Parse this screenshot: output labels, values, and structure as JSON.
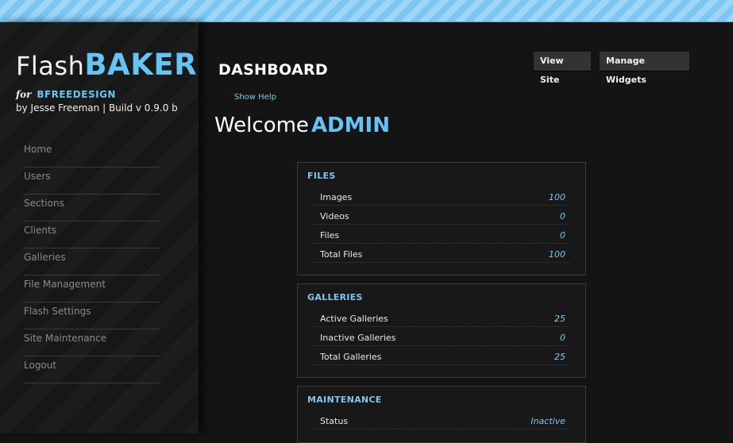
{
  "brand": {
    "name_part1": "Flash",
    "name_part2": "BAKER",
    "for_word": "for",
    "client": "BFREEDESIGN",
    "byline": "by Jesse Freeman | Build v 0.9.0 b"
  },
  "sidebar": {
    "items": [
      {
        "label": "Home"
      },
      {
        "label": "Users"
      },
      {
        "label": "Sections"
      },
      {
        "label": "Clients"
      },
      {
        "label": "Galleries"
      },
      {
        "label": "File Management"
      },
      {
        "label": "Flash Settings"
      },
      {
        "label": "Site Maintenance"
      },
      {
        "label": "Logout"
      }
    ]
  },
  "header": {
    "title": "DASHBOARD",
    "show_help": "Show Help",
    "view_site": "View Site",
    "manage_widgets": "Manage Widgets"
  },
  "welcome": {
    "text": "Welcome",
    "user": "ADMIN"
  },
  "panels": {
    "files": {
      "title": "FILES",
      "rows": [
        {
          "label": "Images",
          "value": "100"
        },
        {
          "label": "Videos",
          "value": "0"
        },
        {
          "label": "Files",
          "value": "0"
        },
        {
          "label": "Total Files",
          "value": "100"
        }
      ]
    },
    "galleries": {
      "title": "GALLERIES",
      "rows": [
        {
          "label": "Active Galleries",
          "value": "25"
        },
        {
          "label": "Inactive Galleries",
          "value": "0"
        },
        {
          "label": "Total Galleries",
          "value": "25"
        }
      ]
    },
    "maintenance": {
      "title": "MAINTENANCE",
      "rows": [
        {
          "label": "Status",
          "value": "Inactive"
        }
      ]
    }
  },
  "colors": {
    "accent": "#66c4f5",
    "background": "#141414",
    "top_bar": "#8ccff5"
  }
}
